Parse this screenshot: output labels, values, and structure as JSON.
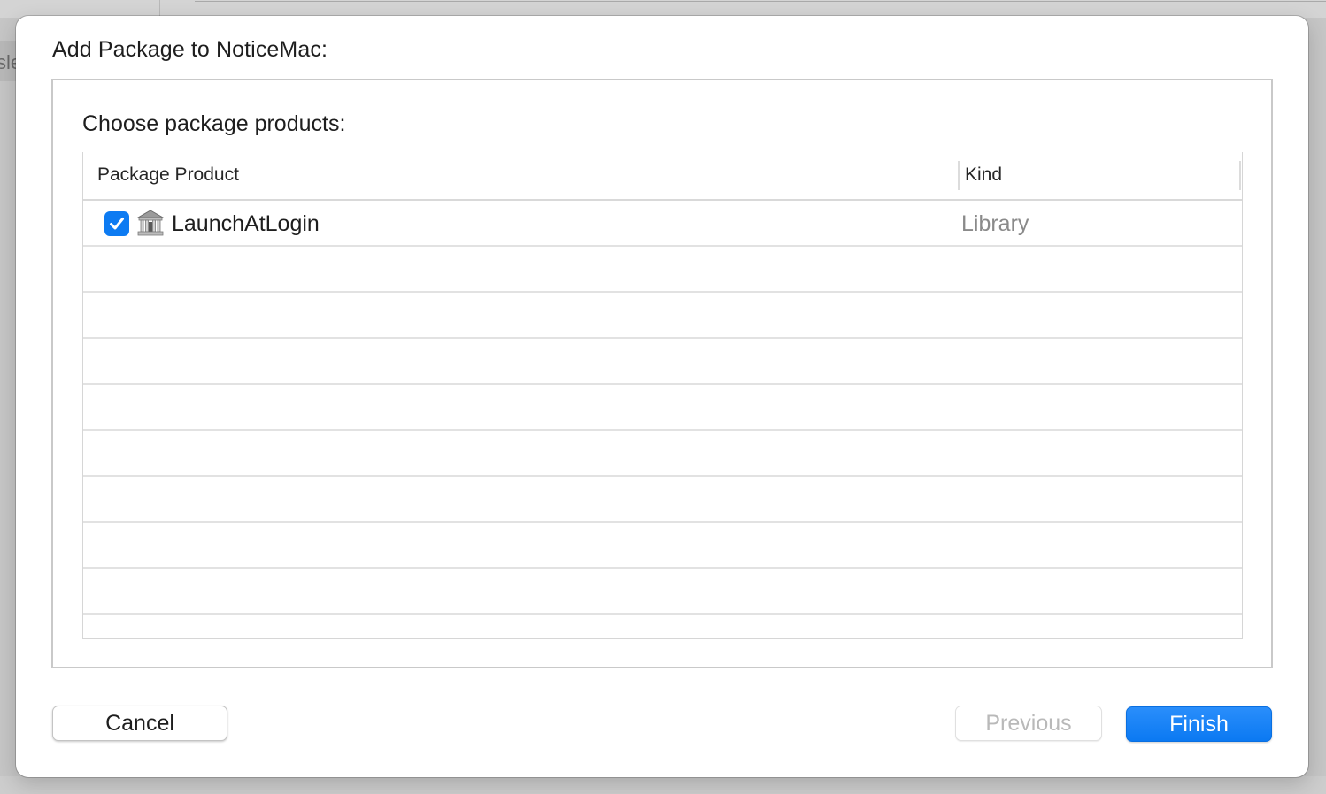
{
  "background": {
    "sidebar_partial_text": "sle"
  },
  "dialog": {
    "title": "Add Package to NoticeMac:",
    "subtitle": "Choose package products:",
    "table": {
      "columns": [
        "Package Product",
        "Kind"
      ],
      "rows": [
        {
          "checked": true,
          "icon": "package-library-icon",
          "product": "LaunchAtLogin",
          "kind": "Library"
        }
      ],
      "empty_rows": 8
    },
    "buttons": {
      "cancel": "Cancel",
      "previous": "Previous",
      "finish": "Finish"
    }
  },
  "colors": {
    "accent": "#0d7bf2",
    "finish_button": "#1483f7",
    "disabled_text": "#b9b9b9",
    "secondary_text": "#8a8a8a"
  }
}
